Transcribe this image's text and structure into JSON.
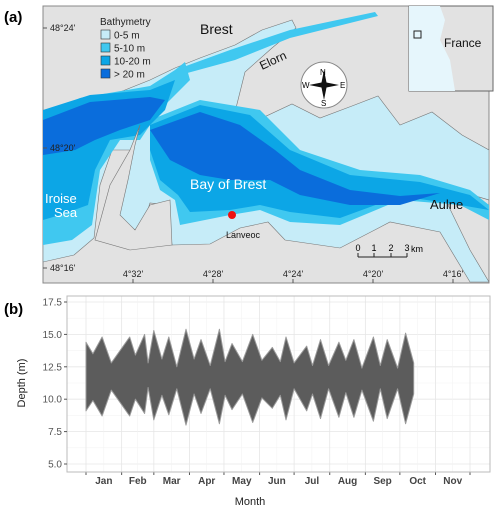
{
  "panel_a": {
    "label": "(a)",
    "legend": {
      "title": "Bathymetry",
      "items": [
        {
          "label": "0-5 m",
          "color": "#c6ecf8"
        },
        {
          "label": "5-10 m",
          "color": "#40c8f0"
        },
        {
          "label": "10-20 m",
          "color": "#0ca6e6"
        },
        {
          "label": "> 20 m",
          "color": "#0a6ddc"
        }
      ]
    },
    "land_color": "#e2e2e2",
    "places": {
      "brest": "Brest",
      "elorn": "Elorn",
      "bay": "Bay of Brest",
      "iroise_1": "Iroise",
      "iroise_2": "Sea",
      "aulne": "Aulne",
      "lanveoc": "Lanveoc"
    },
    "site_marker_color": "#ee1111",
    "inset_label": "France",
    "compass": {
      "n": "N",
      "s": "S",
      "e": "E",
      "w": "W"
    },
    "scale_bar": {
      "ticks": [
        "0",
        "1",
        "2",
        "3"
      ],
      "unit": "km"
    },
    "lat_labels": [
      "48°24'",
      "48°20'",
      "48°16'"
    ],
    "lon_labels": [
      "4°32'",
      "4°28'",
      "4°24'",
      "4°20'",
      "4°16'"
    ]
  },
  "chart_data": {
    "label": "(b)",
    "type": "area",
    "xlabel": "Month",
    "ylabel": "Depth (m)",
    "ylim": [
      5.0,
      17.5
    ],
    "yticks": [
      "5.0",
      "7.5",
      "10.0",
      "12.5",
      "15.0",
      "17.5"
    ],
    "xticks": [
      "Jan",
      "Feb",
      "Mar",
      "Apr",
      "May",
      "Jun",
      "Jul",
      "Aug",
      "Sep",
      "Oct",
      "Nov"
    ],
    "grid": true,
    "fill_color": "#5c5c5c",
    "envelope": [
      {
        "date": "Jan 1",
        "high": 14.4,
        "low": 9.1
      },
      {
        "date": "Jan 7",
        "high": 13.5,
        "low": 9.9
      },
      {
        "date": "Jan 15",
        "high": 14.8,
        "low": 8.7
      },
      {
        "date": "Jan 23",
        "high": 12.8,
        "low": 10.7
      },
      {
        "date": "Feb 8",
        "high": 14.8,
        "low": 8.7
      },
      {
        "date": "Feb 13",
        "high": 13.4,
        "low": 10.0
      },
      {
        "date": "Feb 21",
        "high": 15.0,
        "low": 8.9
      },
      {
        "date": "Feb 24",
        "high": 12.8,
        "low": 10.9
      },
      {
        "date": "Mar 1",
        "high": 15.3,
        "low": 8.4
      },
      {
        "date": "Mar 8",
        "high": 13.1,
        "low": 10.3
      },
      {
        "date": "Mar 14",
        "high": 14.8,
        "low": 8.8
      },
      {
        "date": "Mar 21",
        "high": 12.5,
        "low": 10.8
      },
      {
        "date": "Mar 29",
        "high": 15.4,
        "low": 8.0
      },
      {
        "date": "Apr 5",
        "high": 13.1,
        "low": 10.4
      },
      {
        "date": "Apr 11",
        "high": 14.6,
        "low": 8.9
      },
      {
        "date": "Apr 19",
        "high": 12.6,
        "low": 10.8
      },
      {
        "date": "Apr 27",
        "high": 15.4,
        "low": 8.1
      },
      {
        "date": "May 2",
        "high": 12.9,
        "low": 10.3
      },
      {
        "date": "May 8",
        "high": 14.3,
        "low": 9.2
      },
      {
        "date": "May 17",
        "high": 12.9,
        "low": 10.4
      },
      {
        "date": "May 26",
        "high": 15.0,
        "low": 8.2
      },
      {
        "date": "Jun 3",
        "high": 13.0,
        "low": 10.1
      },
      {
        "date": "Jun 12",
        "high": 14.0,
        "low": 9.3
      },
      {
        "date": "Jun 19",
        "high": 12.9,
        "low": 10.3
      },
      {
        "date": "Jun 24",
        "high": 14.8,
        "low": 8.4
      },
      {
        "date": "Jul 1",
        "high": 12.8,
        "low": 10.8
      },
      {
        "date": "Jul 12",
        "high": 14.1,
        "low": 9.1
      },
      {
        "date": "Jul 17",
        "high": 12.6,
        "low": 10.4
      },
      {
        "date": "Jul 24",
        "high": 14.6,
        "low": 8.5
      },
      {
        "date": "Jul 31",
        "high": 12.6,
        "low": 10.8
      },
      {
        "date": "Aug 9",
        "high": 14.4,
        "low": 8.6
      },
      {
        "date": "Aug 15",
        "high": 13.0,
        "low": 10.5
      },
      {
        "date": "Aug 22",
        "high": 14.6,
        "low": 8.6
      },
      {
        "date": "Aug 29",
        "high": 12.4,
        "low": 10.7
      },
      {
        "date": "Sep 8",
        "high": 14.8,
        "low": 8.3
      },
      {
        "date": "Sep 14",
        "high": 12.6,
        "low": 10.8
      },
      {
        "date": "Sep 20",
        "high": 14.6,
        "low": 8.5
      },
      {
        "date": "Sep 29",
        "high": 12.4,
        "low": 10.8
      },
      {
        "date": "Oct 6",
        "high": 15.1,
        "low": 8.1
      },
      {
        "date": "Oct 13",
        "high": 12.8,
        "low": 10.4
      }
    ]
  }
}
